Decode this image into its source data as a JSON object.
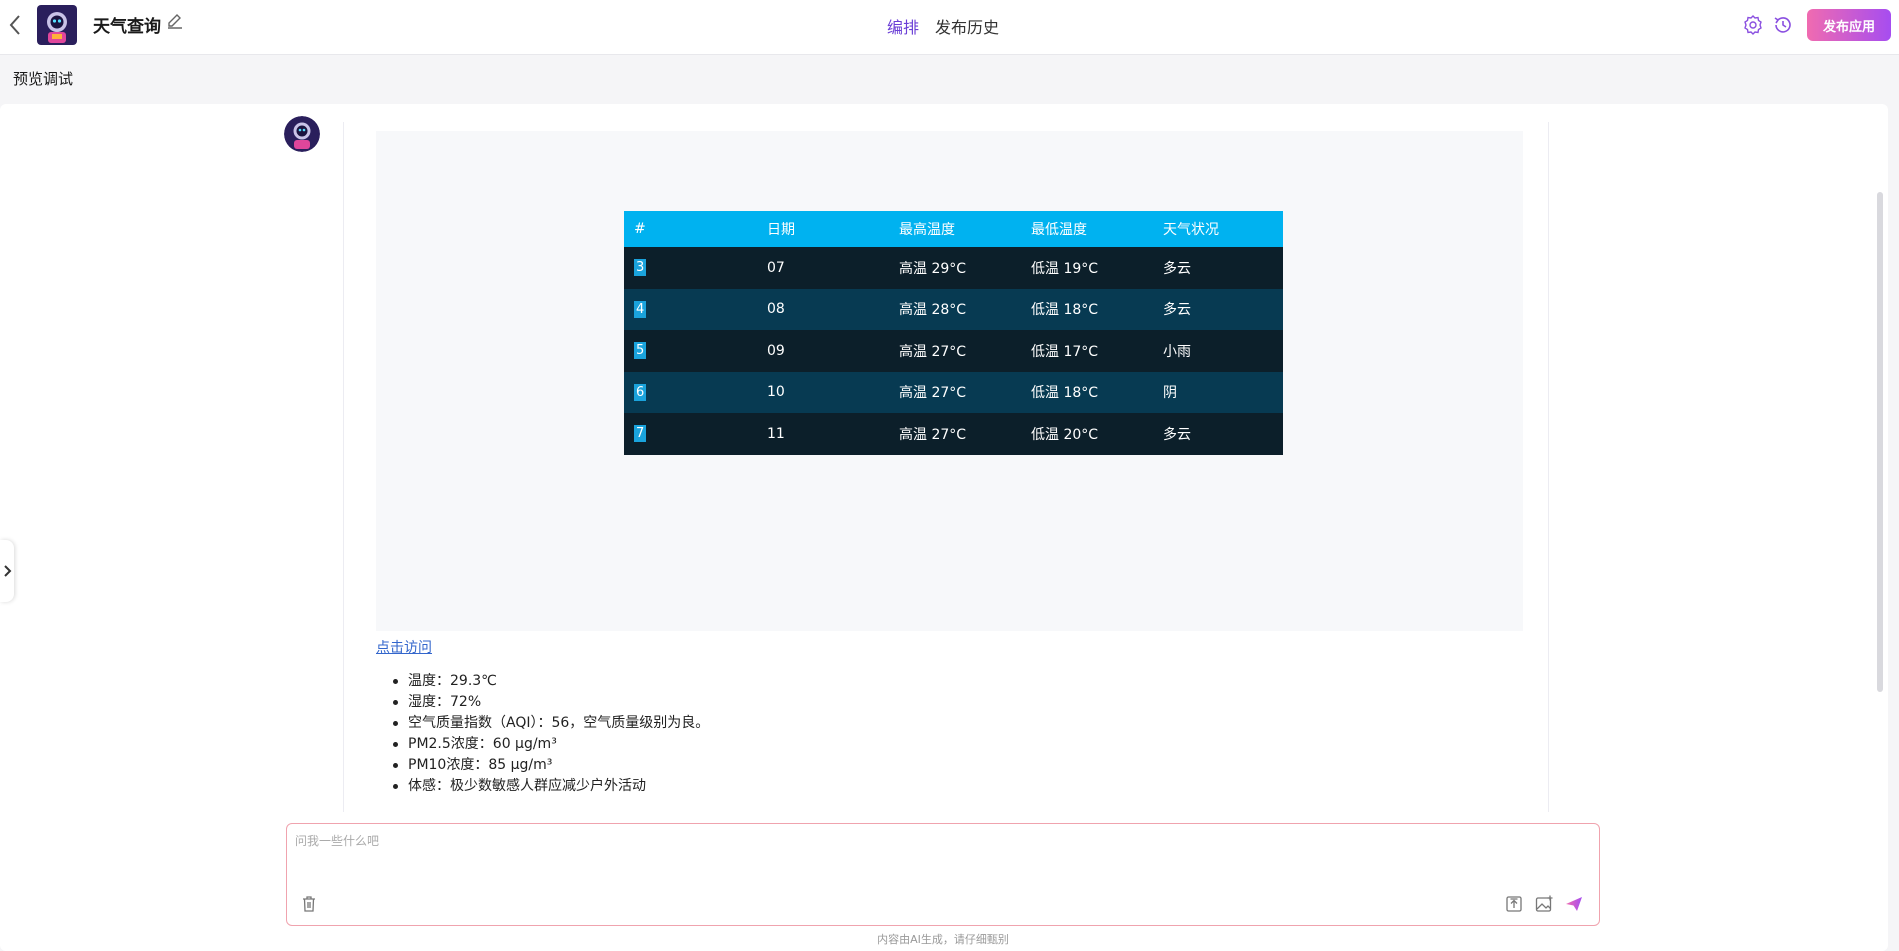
{
  "header": {
    "app_name": "天气查询",
    "tabs": [
      {
        "label": "编排",
        "active": true
      },
      {
        "label": "发布历史",
        "active": false
      }
    ],
    "publish_label": "发布应用",
    "accent_color": "#6b3fd6"
  },
  "subheader": {
    "title": "预览调试"
  },
  "weather_table": {
    "headers": [
      "#",
      "日期",
      "最高温度",
      "最低温度",
      "天气状况"
    ],
    "rows": [
      {
        "num": "3",
        "date": "07",
        "high": "高温 29°C",
        "low": "低温 19°C",
        "cond": "多云"
      },
      {
        "num": "4",
        "date": "08",
        "high": "高温 28°C",
        "low": "低温 18°C",
        "cond": "多云"
      },
      {
        "num": "5",
        "date": "09",
        "high": "高温 27°C",
        "low": "低温 17°C",
        "cond": "小雨"
      },
      {
        "num": "6",
        "date": "10",
        "high": "高温 27°C",
        "low": "低温 18°C",
        "cond": "阴"
      },
      {
        "num": "7",
        "date": "11",
        "high": "高温 27°C",
        "low": "低温 20°C",
        "cond": "多云"
      }
    ]
  },
  "message": {
    "link_text": "点击访问",
    "bullets": [
      "温度：29.3℃",
      "湿度：72%",
      "空气质量指数（AQI）：56，空气质量级别为良。",
      "PM2.5浓度：60 μg/m³",
      "PM10浓度：85 μg/m³",
      "体感：极少数敏感人群应减少户外活动"
    ]
  },
  "input": {
    "placeholder": "问我一些什么吧",
    "disclaimer": "内容由AI生成，请仔细甄别"
  },
  "icons": {
    "back": "chevron-left-icon",
    "edit": "pencil-icon",
    "settings": "gear-icon",
    "history": "clock-history-icon",
    "clear": "trash-icon",
    "upload": "upload-icon",
    "image": "image-add-icon",
    "send": "send-icon"
  }
}
